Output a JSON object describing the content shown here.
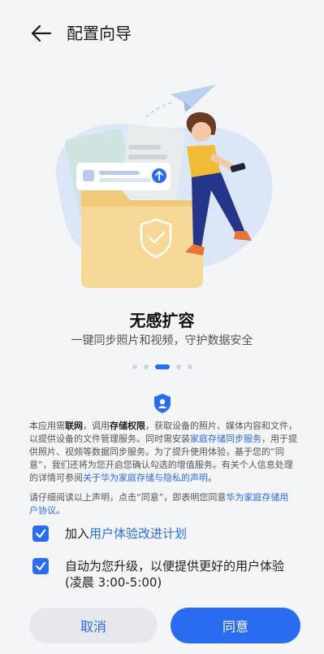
{
  "header": {
    "title": "配置向导"
  },
  "feature": {
    "title": "无感扩容",
    "subtitle": "一键同步照片和视频，守护数据安全"
  },
  "pagination": {
    "count": 5,
    "active_index": 2
  },
  "notice": {
    "p1_a": "本应用需",
    "p1_b": "联网",
    "p1_c": "，调用",
    "p1_d": "存储权限",
    "p1_e": "，获取设备的照片、媒体内容和文件，以提供设备的文件管理服务。同时需安装",
    "p1_link1": "家庭存储同步服务",
    "p1_f": "，用于提供照片、视频等数据同步服务。为了提升使用体验，基于您的“同意”，我们还将为您开启您确认勾选的增值服务。有关个人信息处理的详情可参阅",
    "p1_link2": "关于华为家庭存储与隐私的声明",
    "p1_g": "。",
    "p2_a": "请仔细阅读以上声明，点击“同意”，即表明您同意",
    "p2_link": "华为家庭存储用户协议",
    "p2_b": "。"
  },
  "checkboxes": {
    "ux_plan": {
      "prefix": "加入",
      "link": "用户体验改进计划",
      "checked": true
    },
    "auto_update": {
      "line1": "自动为您升级，以便提供更好的用户体验",
      "line2": "(凌晨 3:00-5:00)",
      "checked": true
    }
  },
  "buttons": {
    "cancel": "取消",
    "agree": "同意"
  },
  "colors": {
    "accent": "#2a6cf0",
    "background": "#f4f5f7"
  }
}
